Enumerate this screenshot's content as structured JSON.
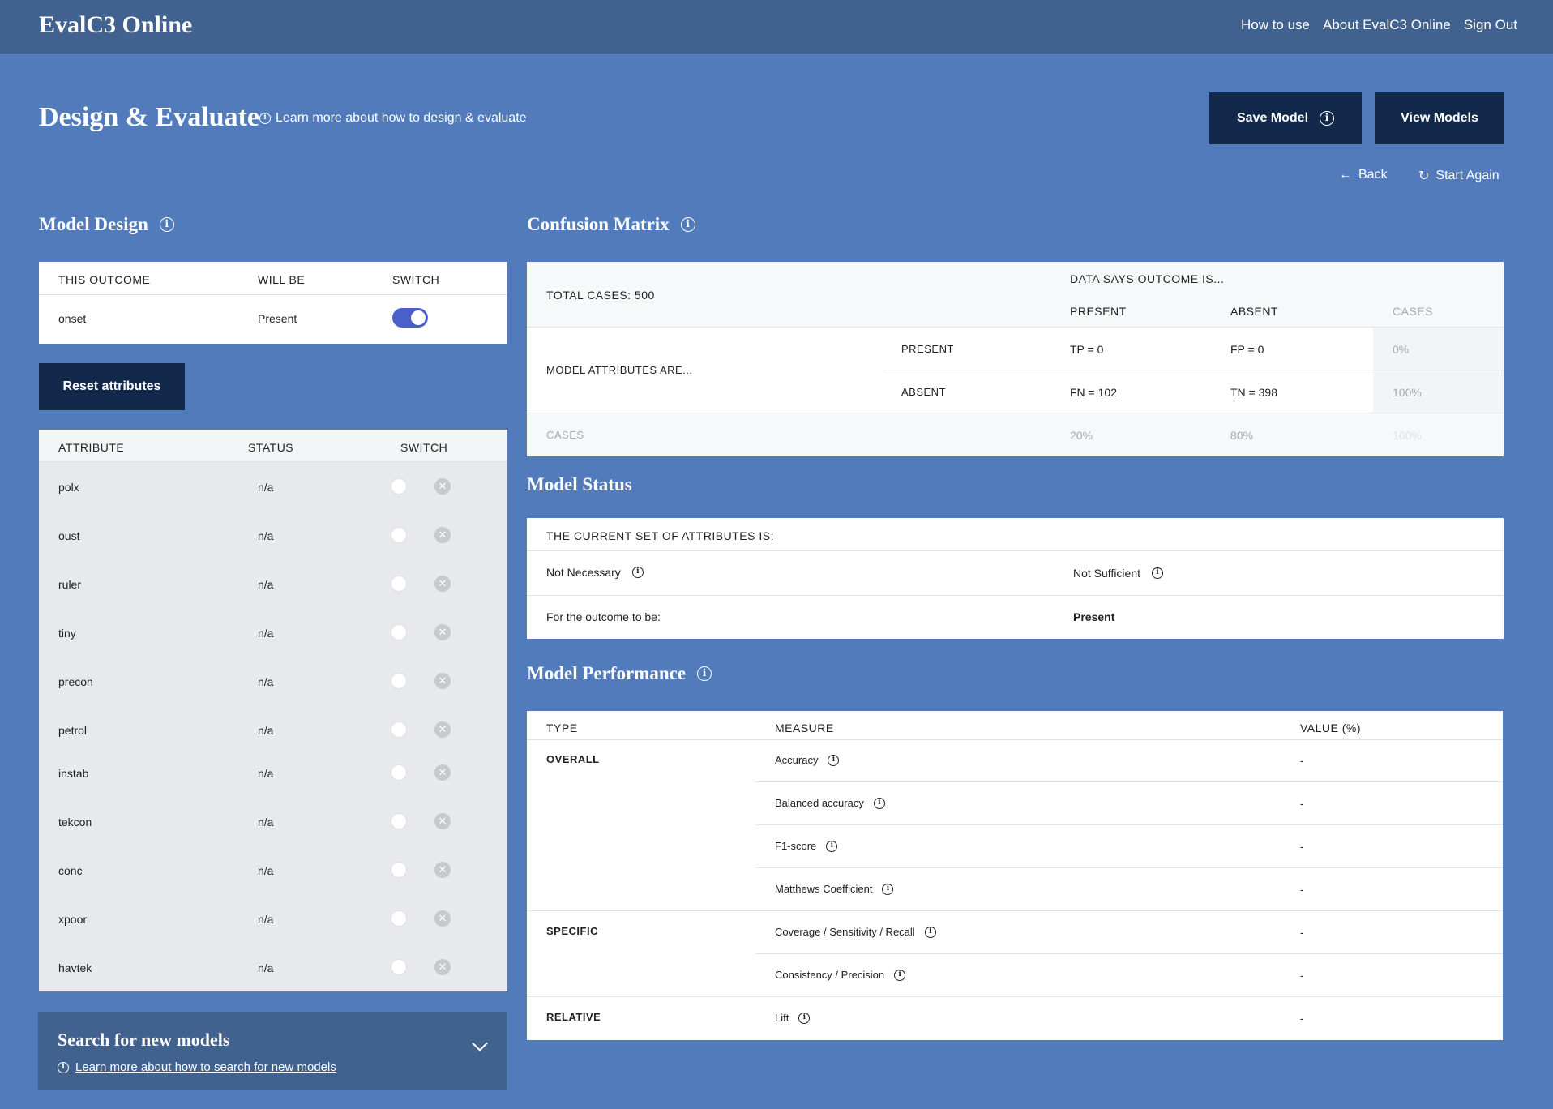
{
  "app": {
    "brand": "EvalC3 Online",
    "nav": [
      "How to use",
      "About EvalC3 Online",
      "Sign Out"
    ]
  },
  "header": {
    "title": "Design & Evaluate",
    "learn_more": "Learn more about how to design & evaluate",
    "save_model": "Save Model",
    "view_models": "View Models",
    "back": "Back",
    "start_again": "Start Again"
  },
  "model_design": {
    "title": "Model Design",
    "outcome_table": {
      "headers": [
        "THIS OUTCOME",
        "WILL BE",
        "SWITCH"
      ],
      "row": {
        "outcome": "onset",
        "will_be": "Present",
        "switch_on": true
      }
    },
    "reset_label": "Reset attributes",
    "attribute_table": {
      "headers": [
        "ATTRIBUTE",
        "STATUS",
        "SWITCH"
      ],
      "rows": [
        {
          "name": "polx",
          "status": "n/a"
        },
        {
          "name": "oust",
          "status": "n/a"
        },
        {
          "name": "ruler",
          "status": "n/a"
        },
        {
          "name": "tiny",
          "status": "n/a"
        },
        {
          "name": "precon",
          "status": "n/a"
        },
        {
          "name": "petrol",
          "status": "n/a"
        },
        {
          "name": "instab",
          "status": "n/a"
        },
        {
          "name": "tekcon",
          "status": "n/a"
        },
        {
          "name": "conc",
          "status": "n/a"
        },
        {
          "name": "xpoor",
          "status": "n/a"
        },
        {
          "name": "havtek",
          "status": "n/a"
        }
      ]
    }
  },
  "search": {
    "title": "Search for new models",
    "learn_more": "Learn more about how to search for new models"
  },
  "confusion_matrix": {
    "title": "Confusion Matrix",
    "total_cases": "TOTAL CASES: 500",
    "data_says": "DATA SAYS OUTCOME IS...",
    "col_present": "PRESENT",
    "col_absent": "ABSENT",
    "col_cases": "CASES",
    "model_attributes": "MODEL ATTRIBUTES ARE...",
    "row_present": "PRESENT",
    "row_absent": "ABSENT",
    "tp": "TP = 0",
    "fp": "FP = 0",
    "present_cases": "0%",
    "fn": "FN = 102",
    "tn": "TN = 398",
    "absent_cases": "100%",
    "cases_label": "CASES",
    "cases_present": "20%",
    "cases_absent": "80%",
    "cases_total": "100%"
  },
  "model_status": {
    "title": "Model Status",
    "header": "THE CURRENT SET OF ATTRIBUTES IS:",
    "necessary": "Not Necessary",
    "sufficient": "Not Sufficient",
    "outcome_label": "For the outcome to be:",
    "outcome_value": "Present"
  },
  "model_performance": {
    "title": "Model Performance",
    "headers": [
      "TYPE",
      "MEASURE",
      "VALUE (%)"
    ],
    "groups": [
      {
        "type": "OVERALL",
        "measures": [
          {
            "name": "Accuracy",
            "value": "-"
          },
          {
            "name": "Balanced accuracy",
            "value": "-"
          },
          {
            "name": "F1-score",
            "value": "-"
          },
          {
            "name": "Matthews Coefficient",
            "value": "-"
          }
        ]
      },
      {
        "type": "SPECIFIC",
        "measures": [
          {
            "name": "Coverage / Sensitivity / Recall",
            "value": "-"
          },
          {
            "name": "Consistency / Precision",
            "value": "-"
          }
        ]
      },
      {
        "type": "RELATIVE",
        "measures": [
          {
            "name": "Lift",
            "value": "-"
          }
        ]
      }
    ]
  },
  "colors": {
    "page_bg": "#527bbb",
    "topbar": "#41618f",
    "dark_button": "#13294b",
    "toggle_on": "#4a5fc9"
  }
}
